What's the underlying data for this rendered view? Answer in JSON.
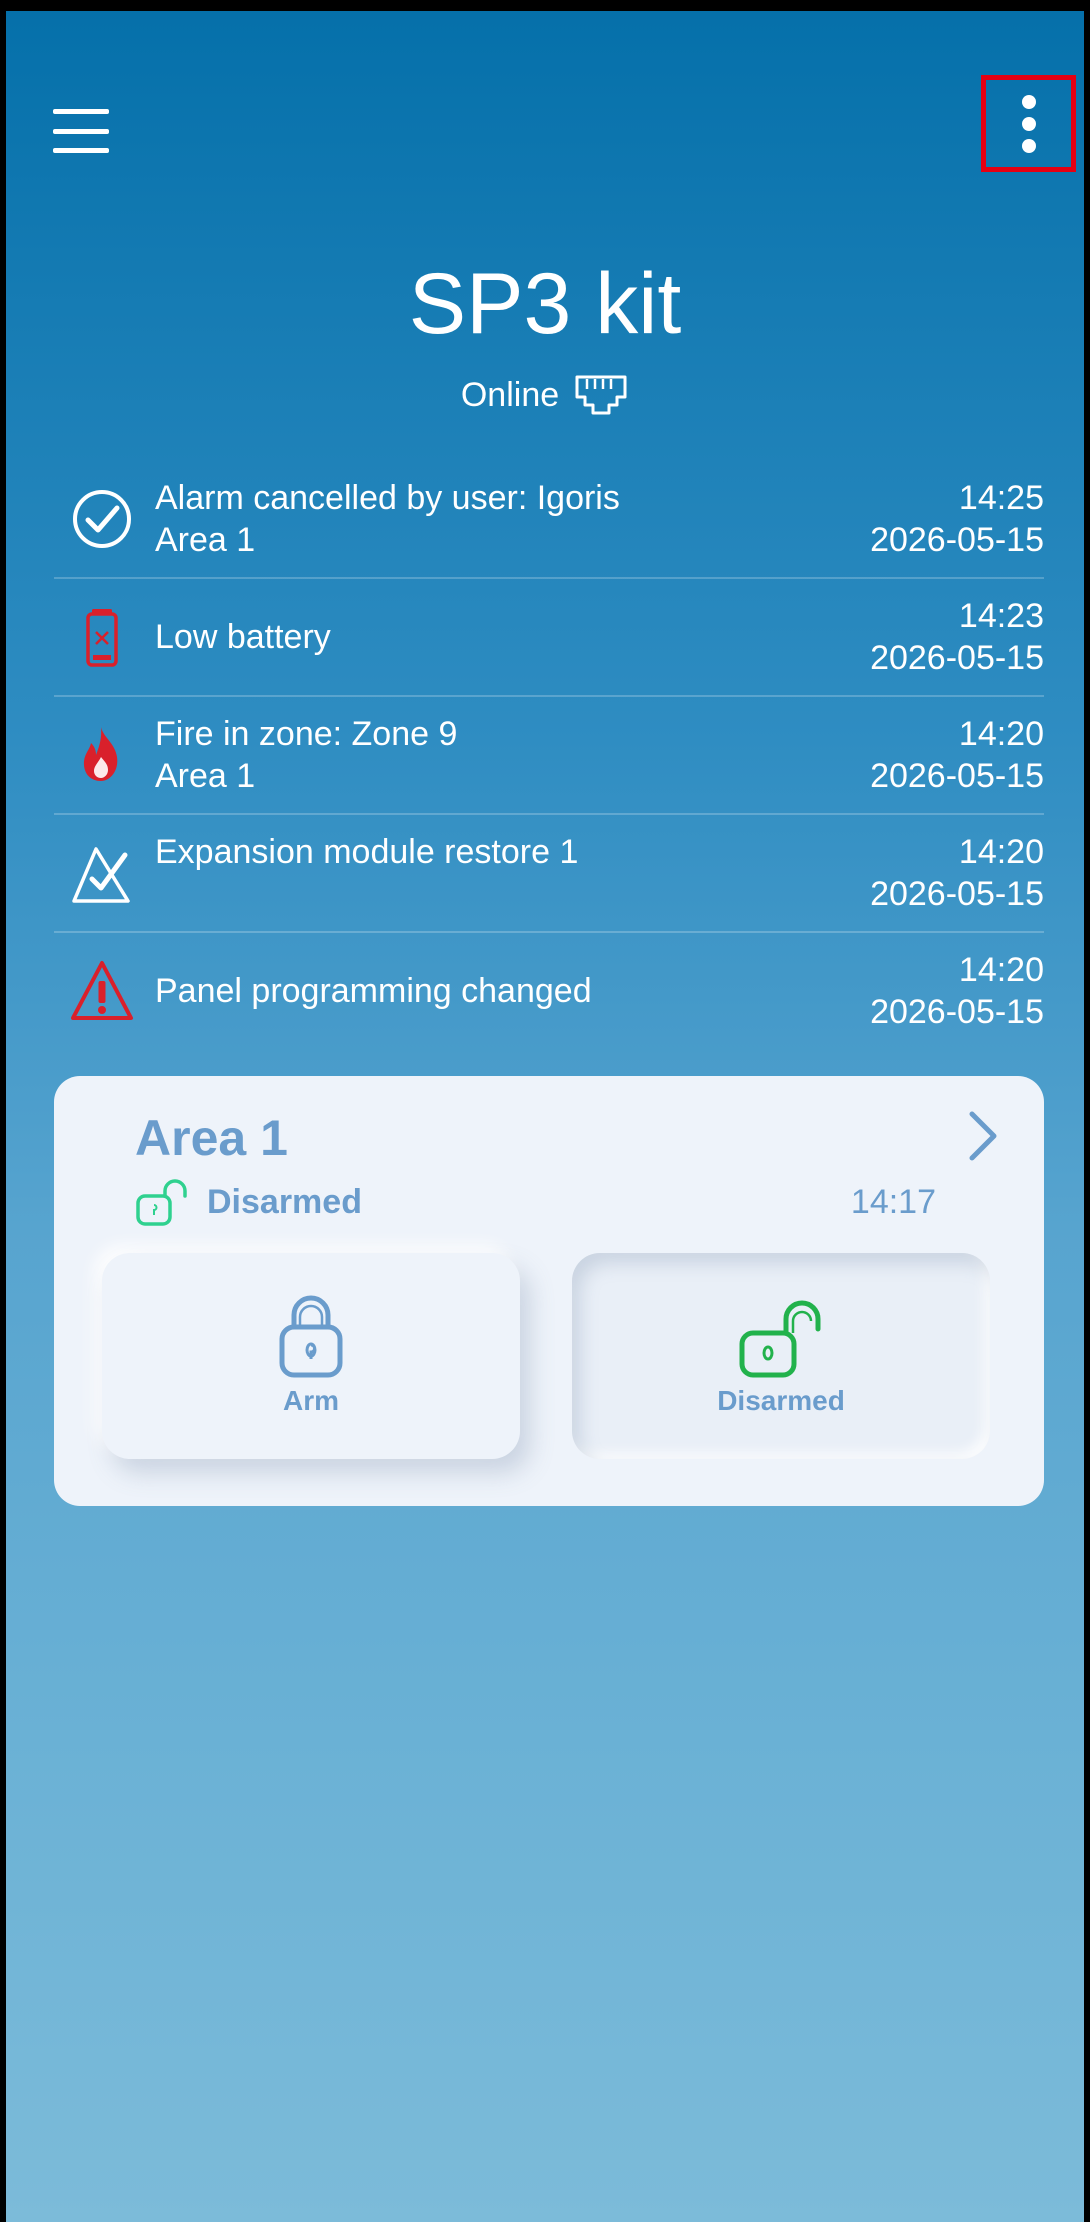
{
  "header": {
    "menu_icon": "hamburger-menu-icon",
    "more_icon": "more-vertical-icon"
  },
  "panel": {
    "title": "SP3 kit",
    "status": "Online",
    "status_icon": "ethernet-port-icon"
  },
  "events": [
    {
      "icon": "check-circle-icon",
      "line1": "Alarm cancelled by user: Igoris",
      "line2": "Area 1",
      "time": "14:25",
      "date": "2026-05-15"
    },
    {
      "icon": "low-battery-icon",
      "line1": "Low battery",
      "line2": "",
      "time": "14:23",
      "date": "2026-05-15"
    },
    {
      "icon": "fire-icon",
      "line1": "Fire in zone: Zone 9",
      "line2": "Area 1",
      "time": "14:20",
      "date": "2026-05-15"
    },
    {
      "icon": "expansion-module-restore-icon",
      "line1": "Expansion module restore 1",
      "line2": "",
      "time": "14:20",
      "date": "2026-05-15"
    },
    {
      "icon": "warning-triangle-icon",
      "line1": "Panel programming changed",
      "line2": "",
      "time": "14:20",
      "date": "2026-05-15"
    }
  ],
  "area": {
    "name": "Area 1",
    "state": "Disarmed",
    "time": "14:17",
    "arm_label": "Arm",
    "disarmed_label": "Disarmed"
  },
  "colors": {
    "accent_blue": "#6a9ccc",
    "green": "#22b24c",
    "teal": "#2fd18f",
    "alert_red": "#d9202b",
    "highlight_red": "#e60012"
  }
}
